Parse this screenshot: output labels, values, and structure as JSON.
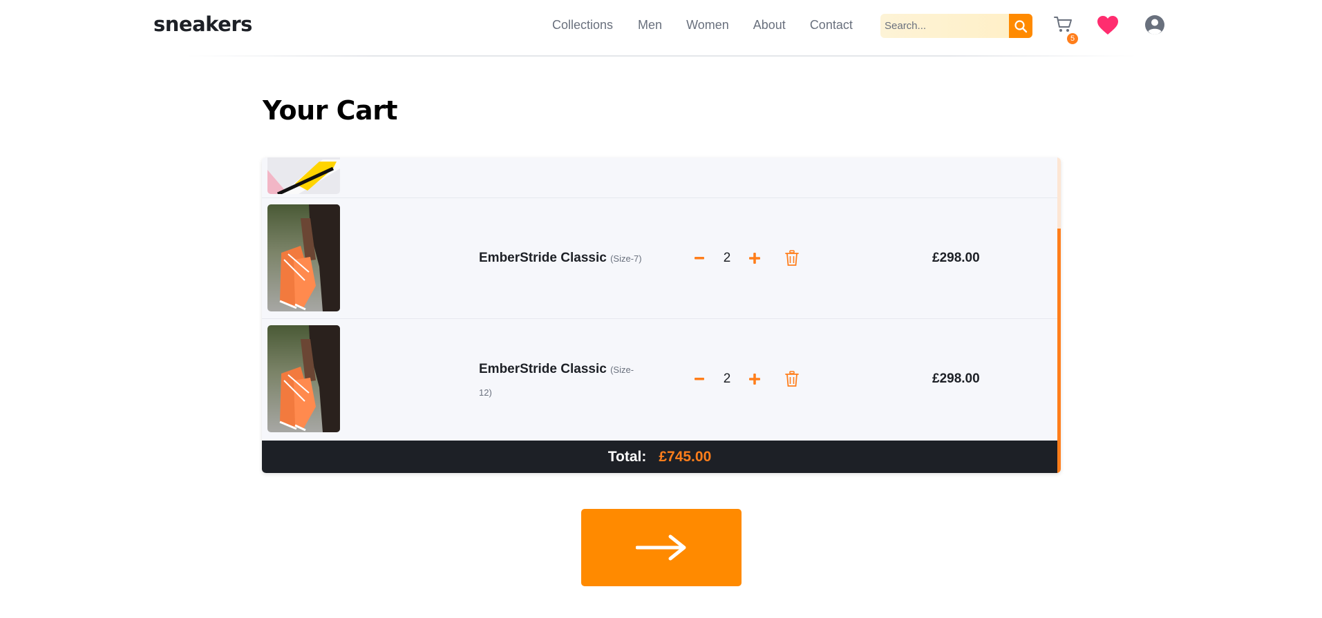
{
  "header": {
    "logo": "sneakers",
    "nav": [
      "Collections",
      "Men",
      "Women",
      "About",
      "Contact"
    ],
    "search": {
      "placeholder": "Search...",
      "value": ""
    },
    "cart_count": "5"
  },
  "page_title": "Your Cart",
  "cart": {
    "items": [
      {
        "name": "",
        "size": "",
        "quantity": "",
        "price": ""
      },
      {
        "name": "EmberStride Classic",
        "size": "(Size-7)",
        "quantity": "2",
        "price": "£298.00"
      },
      {
        "name": "EmberStride Classic",
        "size": "(Size-12)",
        "quantity": "2",
        "price": "£298.00"
      }
    ],
    "total_label": "Total:",
    "total_value": "£745.00"
  },
  "colors": {
    "accent": "#ff7e1b",
    "button": "#ff8a00",
    "heart": "#ff2d6f",
    "dark": "#1d2026",
    "panel_bg": "#f6f7fb"
  },
  "icons": {
    "search": "search-icon",
    "cart": "cart-icon",
    "favorite": "heart-icon",
    "profile": "user-circle-icon",
    "decrease": "minus-icon",
    "increase": "plus-icon",
    "remove": "trash-icon",
    "checkout": "arrow-right-icon"
  }
}
